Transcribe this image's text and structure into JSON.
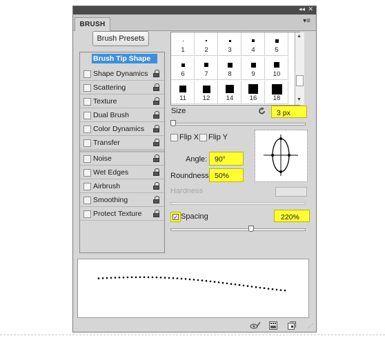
{
  "panel": {
    "tab_label": "BRUSH",
    "collapse_glyph": "◂◂",
    "close_glyph": "✕",
    "menu_glyph": "▾≡",
    "presets_button": "Brush Presets"
  },
  "options": [
    {
      "label": "Brush Tip Shape",
      "selected": true,
      "checkbox": false,
      "lock": false
    },
    {
      "label": "Shape Dynamics",
      "checkbox": true,
      "lock": true
    },
    {
      "label": "Scattering",
      "checkbox": true,
      "lock": true
    },
    {
      "label": "Texture",
      "checkbox": true,
      "lock": true
    },
    {
      "label": "Dual Brush",
      "checkbox": true,
      "lock": true
    },
    {
      "label": "Color Dynamics",
      "checkbox": true,
      "lock": true
    },
    {
      "label": "Transfer",
      "checkbox": true,
      "lock": true
    },
    {
      "label": "Noise",
      "checkbox": true,
      "lock": true
    },
    {
      "label": "Wet Edges",
      "checkbox": true,
      "lock": true
    },
    {
      "label": "Airbrush",
      "checkbox": true,
      "lock": true
    },
    {
      "label": "Smoothing",
      "checkbox": true,
      "lock": true
    },
    {
      "label": "Protect Texture",
      "checkbox": true,
      "lock": true
    }
  ],
  "tips": [
    "1",
    "2",
    "3",
    "4",
    "5",
    "6",
    "7",
    "8",
    "9",
    "10",
    "11",
    "12",
    "14",
    "16",
    "18"
  ],
  "controls": {
    "size_label": "Size",
    "size_value": "3 px",
    "flip_x": "Flip X",
    "flip_y": "Flip Y",
    "angle_label": "Angle:",
    "angle_value": "90°",
    "roundness_label": "Roundness:",
    "roundness_value": "50%",
    "hardness_label": "Hardness",
    "spacing_label": "Spacing",
    "spacing_value": "220%",
    "spacing_checked": true,
    "spacing_check_glyph": "✓",
    "spacing_fraction": 0.6,
    "size_fraction": 0.0
  },
  "colors": {
    "highlight": "#ffff33",
    "selection": "#3d8fe0"
  },
  "icons": [
    "reset-size-icon",
    "lock-icon",
    "toggle-bristle-preview-icon",
    "brush-panel-icon",
    "create-new-brush-icon"
  ]
}
